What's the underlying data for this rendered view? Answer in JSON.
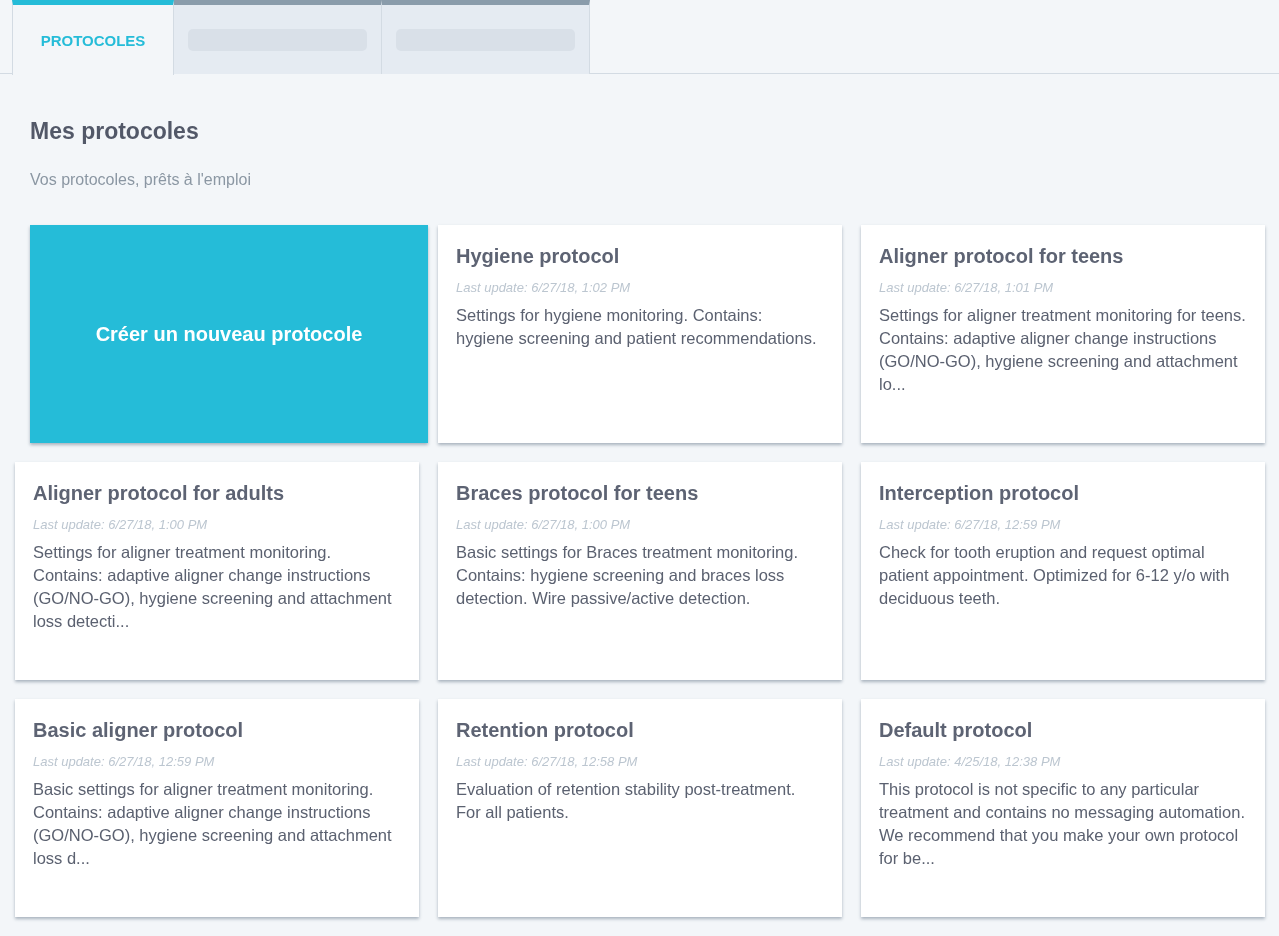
{
  "tabs": [
    {
      "kind": "text",
      "label": "PROTOCOLES",
      "selected": true
    },
    {
      "kind": "skeleton",
      "selected": false
    },
    {
      "kind": "skeleton",
      "selected": false
    }
  ],
  "heading": "Mes protocoles",
  "subheading": "Vos protocoles, prêts à l'emploi",
  "create_button": "Créer un nouveau protocole",
  "protocols": [
    {
      "title": "Hygiene protocol",
      "updated": "Last update: 6/27/18, 1:02 PM",
      "description": "Settings for hygiene monitoring. Contains: hygiene screening and patient recommendations."
    },
    {
      "title": "Aligner protocol for teens",
      "updated": "Last update: 6/27/18, 1:01 PM",
      "description": "Settings for aligner treatment monitoring for teens. Contains: adaptive aligner change instructions (GO/NO-GO), hygiene screening and attachment lo..."
    },
    {
      "title": "Aligner protocol for adults",
      "updated": "Last update: 6/27/18, 1:00 PM",
      "description": "Settings for aligner treatment monitoring. Contains: adaptive aligner change instructions (GO/NO-GO), hygiene screening and attachment loss detecti..."
    },
    {
      "title": "Braces protocol for teens",
      "updated": "Last update: 6/27/18, 1:00 PM",
      "description": "Basic settings for Braces treatment monitoring. Contains: hygiene screening and braces loss detection. Wire passive/active detection."
    },
    {
      "title": "Interception protocol",
      "updated": "Last update: 6/27/18, 12:59 PM",
      "description": "Check for tooth eruption and request optimal patient appointment. Optimized for 6-12 y/o with deciduous teeth."
    },
    {
      "title": "Basic aligner protocol",
      "updated": "Last update: 6/27/18, 12:59 PM",
      "description": "Basic settings for aligner treatment monitoring. Contains: adaptive aligner change instructions (GO/NO-GO), hygiene screening and attachment loss d..."
    },
    {
      "title": "Retention protocol",
      "updated": "Last update: 6/27/18, 12:58 PM",
      "description": "Evaluation of retention stability post-treatment. For all patients."
    },
    {
      "title": "Default protocol",
      "updated": "Last update: 4/25/18, 12:38 PM",
      "description": "This protocol is not specific to any particular treatment and contains no messaging automation. We recommend that you make your own protocol for be..."
    }
  ]
}
